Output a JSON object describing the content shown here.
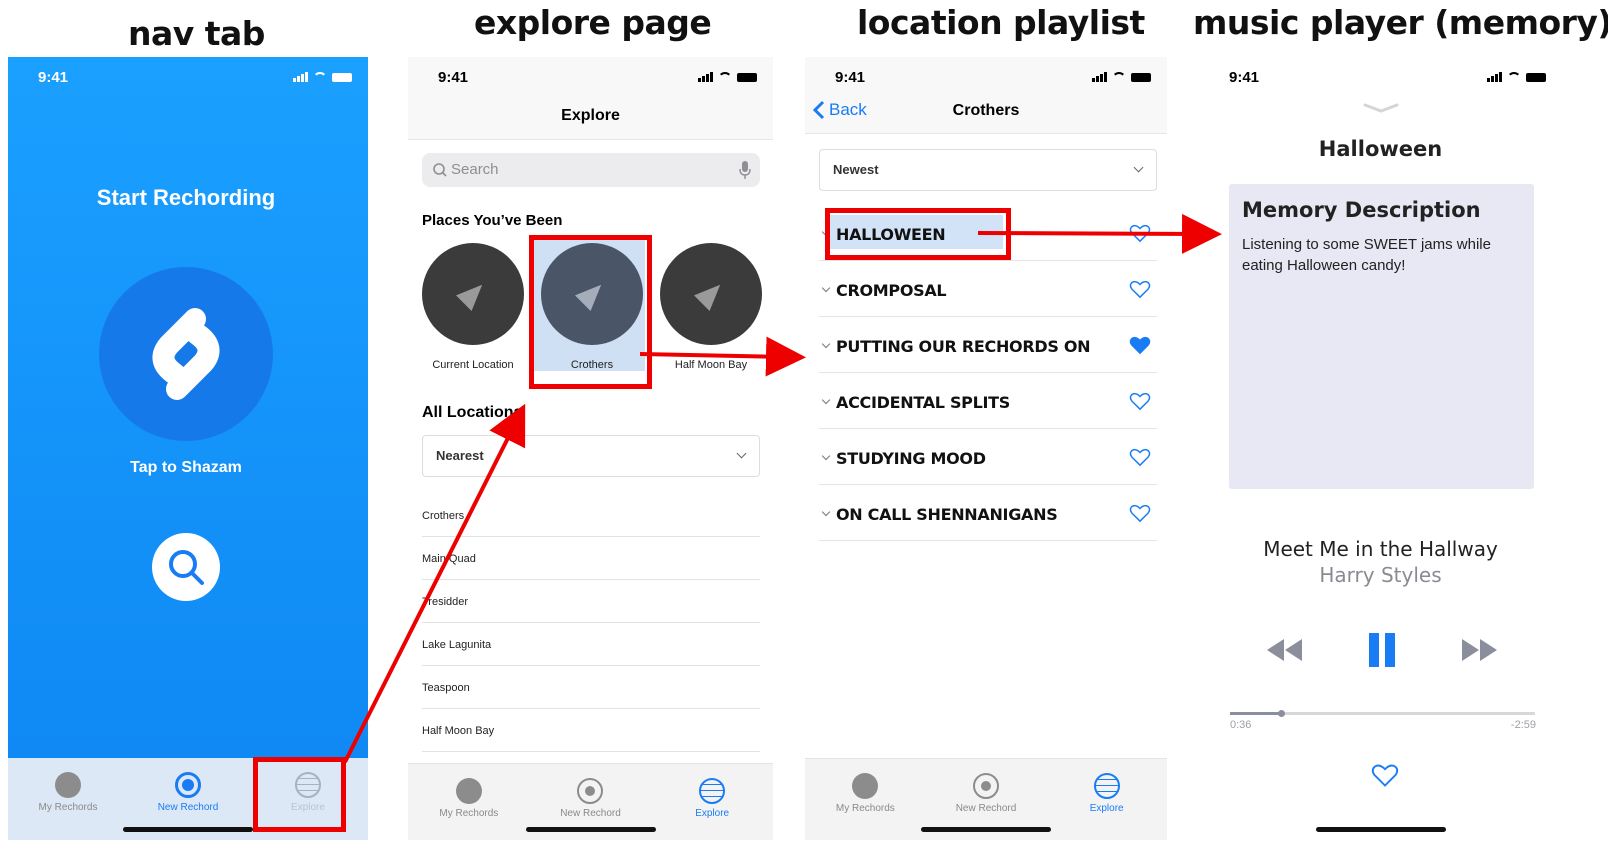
{
  "titles": {
    "nav": "nav tab",
    "explore": "explore page",
    "playlist": "location playlist",
    "player": "music player (memory)"
  },
  "status_time": "9:41",
  "tabs": {
    "my_rechords": "My Rechords",
    "new_rechord": "New Rechord",
    "explore": "Explore"
  },
  "nav_screen": {
    "heading": "Start Rechording",
    "tap_label": "Tap to Shazam"
  },
  "explore_screen": {
    "title": "Explore",
    "search_placeholder": "Search",
    "places_heading": "Places You’ve Been",
    "places": [
      "Current Location",
      "Crothers",
      "Half Moon Bay"
    ],
    "all_locations_heading": "All Locations",
    "sort": "Nearest",
    "locations": [
      "Crothers",
      "Main Quad",
      "Tresidder",
      "Lake Lagunita",
      "Teaspoon",
      "Half Moon Bay"
    ]
  },
  "playlist_screen": {
    "back": "Back",
    "title": "Crothers",
    "sort": "Newest",
    "songs": [
      {
        "name": "HALLOWEEN",
        "liked": false
      },
      {
        "name": "CROMPOSAL",
        "liked": false
      },
      {
        "name": "PUTTING OUR RECHORDS ON",
        "liked": true
      },
      {
        "name": "ACCIDENTAL SPLITS",
        "liked": false
      },
      {
        "name": "STUDYING MOOD",
        "liked": false
      },
      {
        "name": "ON CALL SHENNANIGANS",
        "liked": false
      }
    ]
  },
  "player_screen": {
    "title": "Halloween",
    "memory_heading": "Memory Description",
    "memory_text": "Listening to some SWEET jams while eating Halloween candy!",
    "song": "Meet Me in the Hallway",
    "artist": "Harry Styles",
    "elapsed": "0:36",
    "remaining": "-2:59",
    "progress": 0.17
  },
  "colors": {
    "accent": "#1a7cf5",
    "highlight": "#ee0000",
    "memory_bg": "#e8e7f4"
  }
}
